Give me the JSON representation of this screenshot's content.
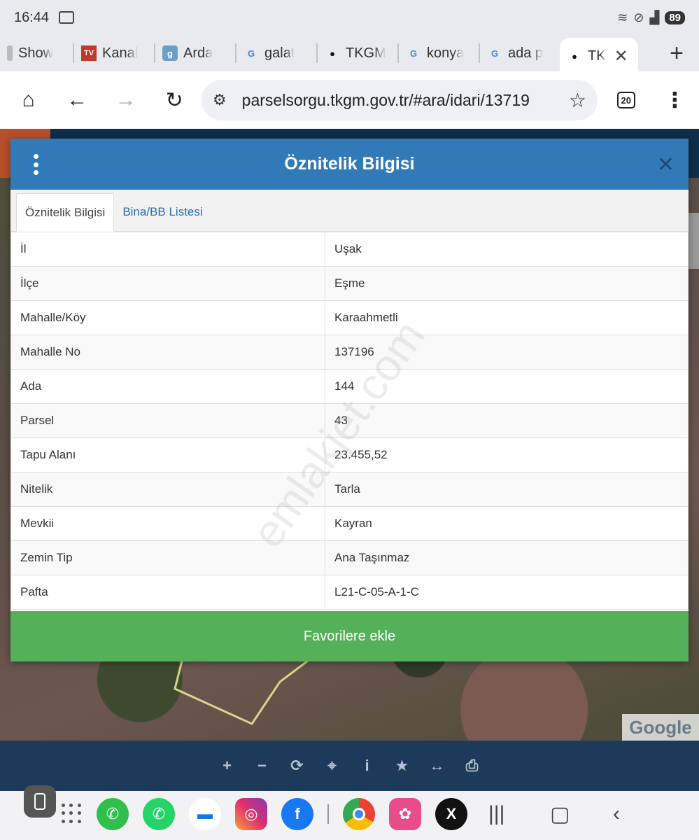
{
  "status_bar": {
    "time": "16:44",
    "battery": "89"
  },
  "browser_tabs": [
    {
      "label": "Show",
      "favicon": "show-favicon",
      "fav_text": "",
      "fav_color": "#bbbbbb"
    },
    {
      "label": "Kanal",
      "favicon": "tv-favicon",
      "fav_text": "TV",
      "fav_color": "#c0392b"
    },
    {
      "label": "Arda",
      "favicon": "g-box-favicon",
      "fav_text": "g",
      "fav_color": "#6aa0c8"
    },
    {
      "label": "galat",
      "favicon": "google-favicon",
      "fav_text": "G",
      "fav_color": "#4285f4"
    },
    {
      "label": "TKGM",
      "favicon": "map-pin-favicon",
      "fav_text": "●",
      "fav_color": "#111111"
    },
    {
      "label": "konya",
      "favicon": "google-favicon",
      "fav_text": "G",
      "fav_color": "#4285f4"
    },
    {
      "label": "ada p",
      "favicon": "google-favicon",
      "fav_text": "G",
      "fav_color": "#4285f4"
    }
  ],
  "active_tab": {
    "label": "TK",
    "favicon": "map-pin-favicon"
  },
  "address_bar": {
    "url": "parselsorgu.tkgm.gov.tr/#ara/idari/13719",
    "tab_count": "20"
  },
  "modal": {
    "title": "Öznitelik Bilgisi",
    "tabs": [
      "Öznitelik Bilgisi",
      "Bina/BB Listesi"
    ],
    "rows": [
      {
        "key": "İl",
        "value": "Uşak"
      },
      {
        "key": "İlçe",
        "value": "Eşme"
      },
      {
        "key": "Mahalle/Köy",
        "value": "Karaahmetli"
      },
      {
        "key": "Mahalle No",
        "value": "137196"
      },
      {
        "key": "Ada",
        "value": "144"
      },
      {
        "key": "Parsel",
        "value": "43"
      },
      {
        "key": "Tapu Alanı",
        "value": "23.455,52"
      },
      {
        "key": "Nitelik",
        "value": "Tarla"
      },
      {
        "key": "Mevkii",
        "value": "Kayran"
      },
      {
        "key": "Zemin Tip",
        "value": "Ana Taşınmaz"
      },
      {
        "key": "Pafta",
        "value": "L21-C-05-A-1-C"
      }
    ],
    "favorite_button": "Favorilere ekle",
    "watermark": "emlakjet.com"
  },
  "map": {
    "google_label": "Google"
  },
  "map_tools": [
    "plus-icon",
    "minus-icon",
    "refresh-icon",
    "locate-icon",
    "info-icon",
    "star-icon",
    "measure-icon",
    "print-icon"
  ],
  "colors": {
    "header_blue": "#3279b7",
    "favorite_green": "#55b05a",
    "tool_bar": "#1d3a5a"
  }
}
